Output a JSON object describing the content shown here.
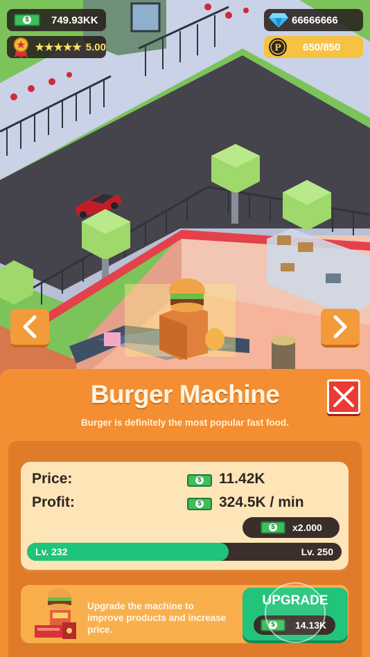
{
  "hud": {
    "cash": "749.93KK",
    "rating": "5.00",
    "rating_stars": 5,
    "gems": "66666666",
    "points": "650/850",
    "points_icon": "P"
  },
  "machine": {
    "title": "Burger Machine",
    "description": "Burger is definitely the most popular fast food.",
    "price_label": "Price:",
    "price_value": "11.42K",
    "profit_label": "Profit:",
    "profit_value": "324.5K / min",
    "multiplier": "x2.000",
    "level_current": "Lv. 232",
    "level_max": "Lv. 250",
    "level_progress": 0.64
  },
  "upgrade": {
    "text": "Upgrade the machine to improve products and increase price.",
    "button_label": "UPGRADE",
    "cost": "14.13K"
  },
  "icons": {
    "cash": "cash-bill-icon",
    "gem": "diamond-icon",
    "medal": "medal-icon",
    "coin": "p-coin-icon",
    "prev": "chevron-left-icon",
    "next": "chevron-right-icon",
    "close": "close-icon"
  },
  "colors": {
    "panel": "#f48e33",
    "card": "#fde5b8",
    "progress": "#1ec479",
    "upgrade_button": "#22c37a",
    "close_button": "#ea3a33",
    "points_pill": "#f6c244"
  }
}
